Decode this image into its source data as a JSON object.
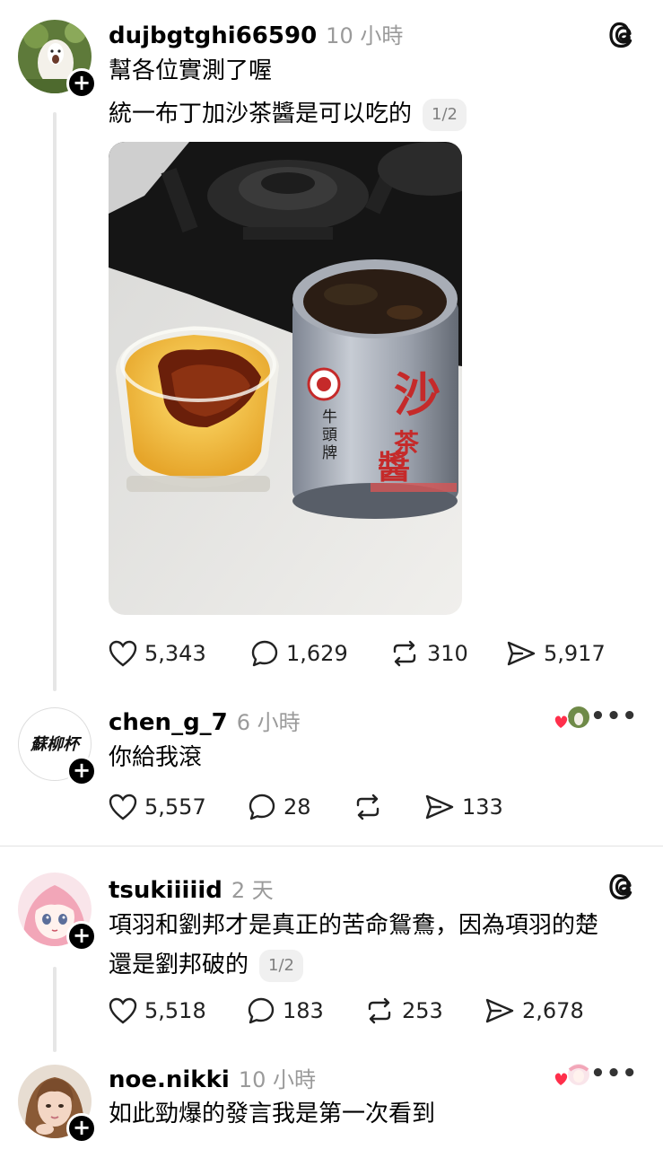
{
  "posts": [
    {
      "username": "dujbgtghi66590",
      "time": "10 小時",
      "lines": [
        "幫各位實測了喔",
        "統一布丁加沙茶醬是可以吃的"
      ],
      "pager": "1/2",
      "image": {
        "can_label": "沙茶醬",
        "can_brand": "牛頭牌"
      },
      "stats": {
        "likes": "5,343",
        "replies": "1,629",
        "reposts": "310",
        "shares": "5,917"
      }
    },
    {
      "username": "chen_g_7",
      "time": "6 小時",
      "avatar_text": "蘇柳杯",
      "lines": [
        "你給我滾"
      ],
      "stats": {
        "likes": "5,557",
        "replies": "28",
        "reposts": "",
        "shares": "133"
      }
    },
    {
      "username": "tsukiiiiid",
      "time": "2 天",
      "lines": [
        "項羽和劉邦才是真正的苦命鴛鴦，因為項羽的楚",
        "還是劉邦破的"
      ],
      "pager": "1/2",
      "stats": {
        "likes": "5,518",
        "replies": "183",
        "reposts": "253",
        "shares": "2,678"
      }
    },
    {
      "username": "noe.nikki",
      "time": "10 小時",
      "lines": [
        "如此勁爆的發言我是第一次看到"
      ]
    }
  ],
  "colors": {
    "like_red": "#ff2f4b",
    "muted": "#9a9a9a",
    "divider": "#e2e2e2"
  }
}
